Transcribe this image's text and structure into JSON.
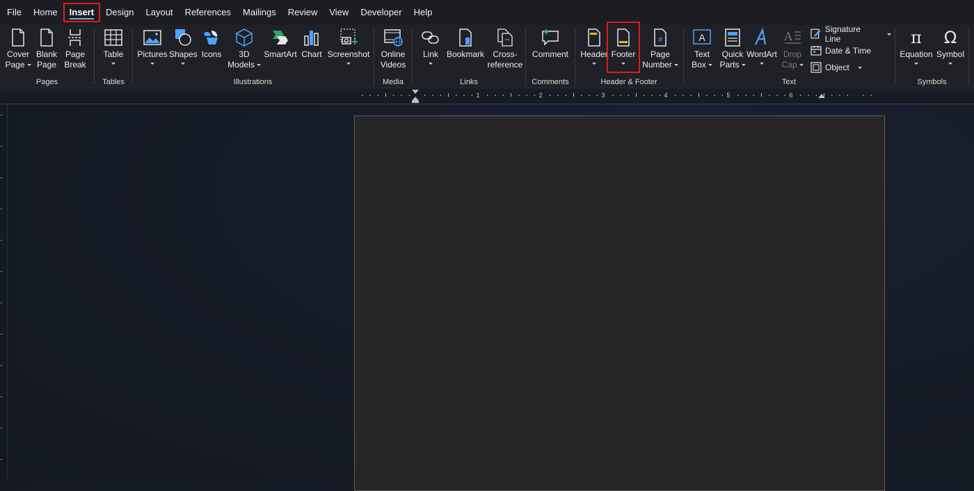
{
  "menu": {
    "tabs": [
      "File",
      "Home",
      "Insert",
      "Design",
      "Layout",
      "References",
      "Mailings",
      "Review",
      "View",
      "Developer",
      "Help"
    ],
    "active": "Insert"
  },
  "ribbon": {
    "pages": {
      "label": "Pages",
      "cover_l1": "Cover",
      "cover_l2": "Page",
      "blank_l1": "Blank",
      "blank_l2": "Page",
      "break_l1": "Page",
      "break_l2": "Break"
    },
    "tables": {
      "label": "Tables",
      "table": "Table"
    },
    "illustrations": {
      "label": "Illustrations",
      "pictures": "Pictures",
      "shapes": "Shapes",
      "icons": "Icons",
      "models_l1": "3D",
      "models_l2": "Models",
      "smartart": "SmartArt",
      "chart": "Chart",
      "screenshot": "Screenshot"
    },
    "media": {
      "label": "Media",
      "videos_l1": "Online",
      "videos_l2": "Videos"
    },
    "links": {
      "label": "Links",
      "link": "Link",
      "bookmark": "Bookmark",
      "xref_l1": "Cross-",
      "xref_l2": "reference"
    },
    "comments": {
      "label": "Comments",
      "comment": "Comment"
    },
    "header_footer": {
      "label": "Header & Footer",
      "header": "Header",
      "footer": "Footer",
      "pagenum_l1": "Page",
      "pagenum_l2": "Number"
    },
    "text": {
      "label": "Text",
      "textbox_l1": "Text",
      "textbox_l2": "Box",
      "quick_l1": "Quick",
      "quick_l2": "Parts",
      "wordart": "WordArt",
      "dropcap_l1": "Drop",
      "dropcap_l2": "Cap",
      "signature": "Signature Line",
      "datetime": "Date & Time",
      "object": "Object"
    },
    "symbols": {
      "label": "Symbols",
      "equation": "Equation",
      "symbol": "Symbol"
    }
  },
  "ruler": {
    "numbers": [
      "1",
      "2",
      "3",
      "4",
      "5",
      "6"
    ]
  },
  "colors": {
    "accent": "#4da3ff",
    "highlight": "#e01b1b",
    "footer_band": "#f0b429",
    "ribbon_bg": "#1f2126"
  }
}
